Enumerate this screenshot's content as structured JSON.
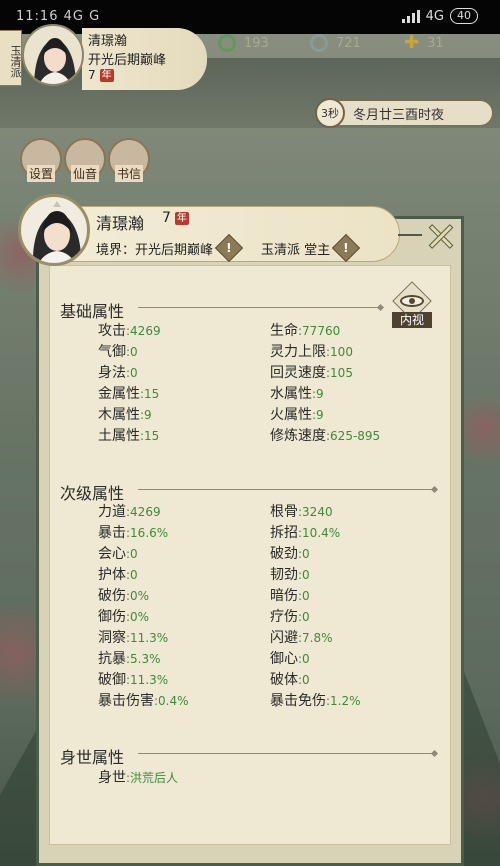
{
  "status_bar": {
    "left_text": "11:16 4G G",
    "network": "4G",
    "battery": "40"
  },
  "hud": {
    "sect_short": "玉清派",
    "name": "清璟瀚",
    "realm": "开光后期巅峰",
    "age": "7",
    "age_unit": "年",
    "resources": [
      {
        "icon": "jade-coin-icon",
        "value": "193",
        "color": "#5f9a5a"
      },
      {
        "icon": "spirit-stone-icon",
        "value": "721",
        "color": "#8a9a98"
      },
      {
        "icon": "gold-cross-icon",
        "value": "31",
        "color": "#c9a53a"
      }
    ],
    "timer_seconds": "3秒",
    "calendar": "冬月廿三酉时夜",
    "buttons": [
      "设置",
      "仙音",
      "书信"
    ]
  },
  "character": {
    "name": "清璟瀚",
    "age": "7",
    "age_unit": "年",
    "realm_label": "境界：开光后期巅峰",
    "sect_label": "玉清派 堂主",
    "inspect_label": "内视"
  },
  "sections": {
    "basic_title": "基础属性",
    "secondary_title": "次级属性",
    "background_title": "身世属性"
  },
  "basic_stats": [
    {
      "label": "攻击",
      "value": ":4269"
    },
    {
      "label": "生命",
      "value": ":77760"
    },
    {
      "label": "气御",
      "value": ":0"
    },
    {
      "label": "灵力上限",
      "value": ":100"
    },
    {
      "label": "身法",
      "value": ":0"
    },
    {
      "label": "回灵速度",
      "value": ":105"
    },
    {
      "label": "金属性",
      "value": ":15"
    },
    {
      "label": "水属性",
      "value": ":9"
    },
    {
      "label": "木属性",
      "value": ":9"
    },
    {
      "label": "火属性",
      "value": ":9"
    },
    {
      "label": "土属性",
      "value": ":15"
    },
    {
      "label": "修炼速度",
      "value": ":625-895"
    }
  ],
  "secondary_stats": [
    {
      "label": "力道",
      "value": ":4269"
    },
    {
      "label": "根骨",
      "value": ":3240"
    },
    {
      "label": "暴击",
      "value": ":16.6%"
    },
    {
      "label": "拆招",
      "value": ":10.4%"
    },
    {
      "label": "会心",
      "value": ":0"
    },
    {
      "label": "破劲",
      "value": ":0"
    },
    {
      "label": "护体",
      "value": ":0"
    },
    {
      "label": "韧劲",
      "value": ":0"
    },
    {
      "label": "破伤",
      "value": ":0%"
    },
    {
      "label": "暗伤",
      "value": ":0"
    },
    {
      "label": "御伤",
      "value": ":0%"
    },
    {
      "label": "疗伤",
      "value": ":0"
    },
    {
      "label": "洞察",
      "value": ":11.3%"
    },
    {
      "label": "闪避",
      "value": ":7.8%"
    },
    {
      "label": "抗暴",
      "value": ":5.3%"
    },
    {
      "label": "御心",
      "value": ":0"
    },
    {
      "label": "破御",
      "value": ":11.3%"
    },
    {
      "label": "破体",
      "value": ":0"
    },
    {
      "label": "暴击伤害",
      "value": ":0.4%"
    },
    {
      "label": "暴击免伤",
      "value": ":1.2%"
    }
  ],
  "background_stats": [
    {
      "label": "身世",
      "value": ":洪荒后人"
    }
  ]
}
